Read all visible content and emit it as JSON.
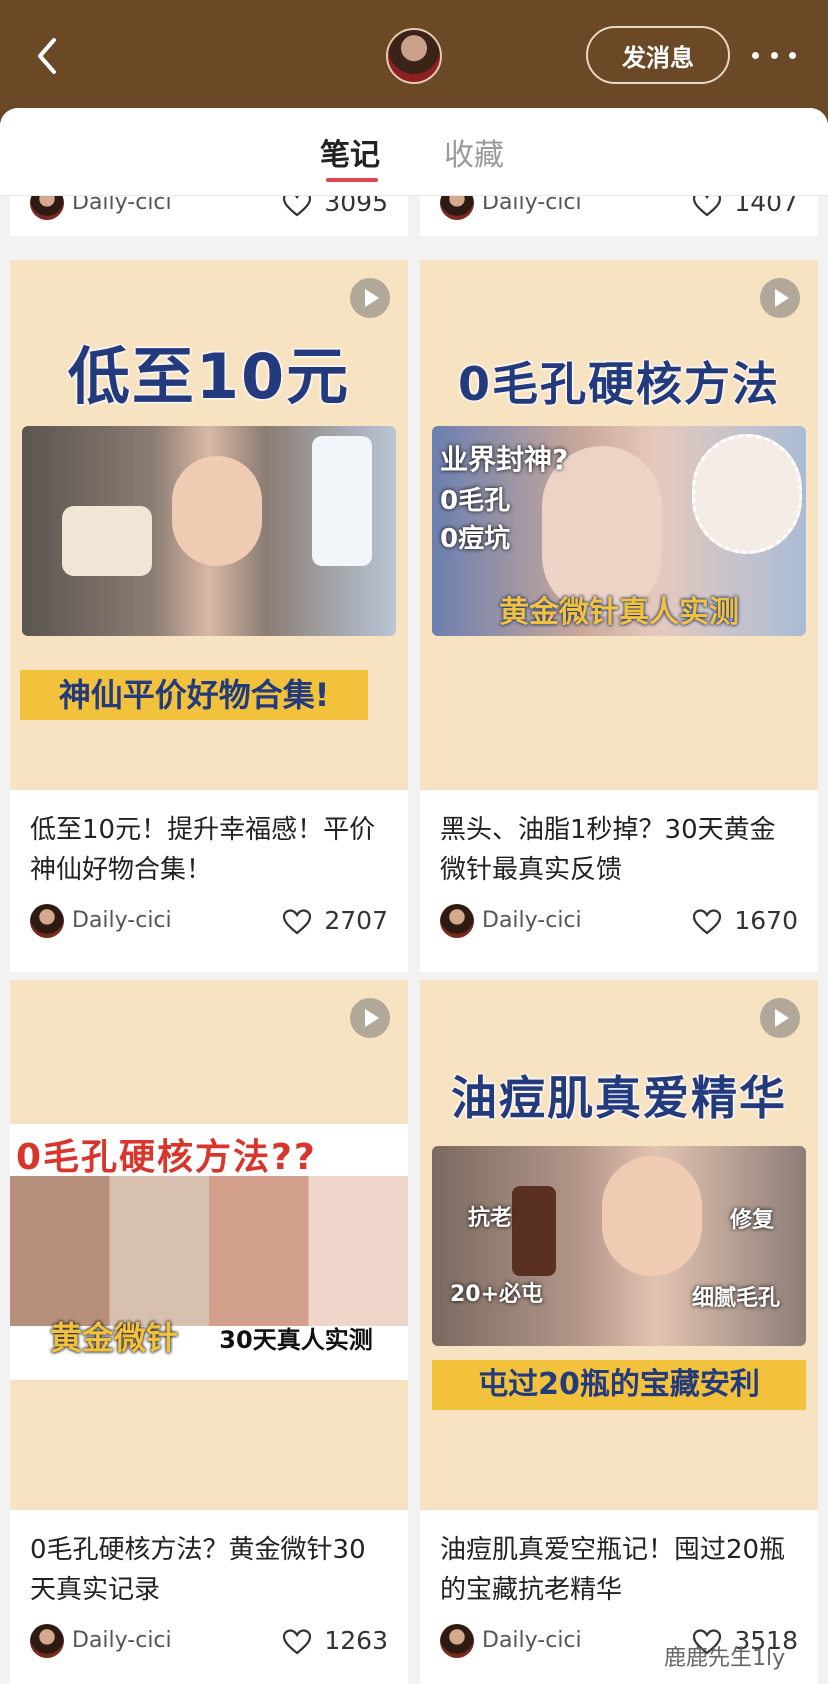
{
  "header": {
    "message_button": "发消息"
  },
  "tabs": [
    "笔记",
    "收藏"
  ],
  "cards": [
    {
      "title": "",
      "author": "Daily-cici",
      "likes": "3095"
    },
    {
      "title": "",
      "author": "Daily-cici",
      "likes": "1407"
    },
    {
      "title": "低至10元！提升幸福感！平价神仙好物合集！",
      "author": "Daily-cici",
      "likes": "2707",
      "cover": {
        "headline": "低至10元",
        "band": "神仙平价好物合集!"
      }
    },
    {
      "title": "黑头、油脂1秒掉？30天黄金微针最真实反馈",
      "author": "Daily-cici",
      "likes": "1670",
      "cover": {
        "headline": "0毛孔硬核方法",
        "overlay1": "业界封神?",
        "overlay2": "0毛孔",
        "overlay3": "0痘坑",
        "band": "黄金微针真人实测"
      }
    },
    {
      "title": "0毛孔硬核方法？黄金微针30天真实记录",
      "author": "Daily-cici",
      "likes": "1263",
      "cover": {
        "headline": "0毛孔硬核方法??",
        "band1": "黄金微针",
        "band2": "30天真人实测"
      }
    },
    {
      "title": "油痘肌真爱空瓶记！囤过20瓶的宝藏抗老精华",
      "author": "Daily-cici",
      "likes": "3518",
      "cover": {
        "headline": "油痘肌真爱精华",
        "tag1": "抗老",
        "tag2": "修复",
        "tag3": "20+必屯",
        "tag4": "细腻毛孔",
        "band": "屯过20瓶的宝藏安利"
      }
    }
  ],
  "watermark": "鹿鹿先生1ly"
}
